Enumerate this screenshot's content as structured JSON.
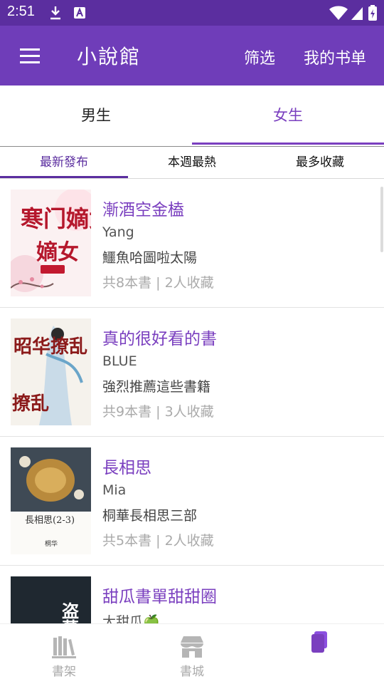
{
  "status_bar": {
    "time": "2:51"
  },
  "app_bar": {
    "title": "小說館",
    "filter_label": "筛选",
    "my_booklist_label": "我的书单"
  },
  "gender_tabs": [
    {
      "label": "男生",
      "active": false
    },
    {
      "label": "女生",
      "active": true
    }
  ],
  "sort_tabs": [
    {
      "label": "最新發布",
      "active": true
    },
    {
      "label": "本週最熱",
      "active": false
    },
    {
      "label": "最多收藏",
      "active": false
    }
  ],
  "booklists": [
    {
      "title": "漸酒空金榼",
      "author": "Yang",
      "description": "鱷魚哈圖啦太陽",
      "stats": "共8本書 | 2人收藏",
      "cover_text": "寒门嫡女"
    },
    {
      "title": "真的很好看的書",
      "author": "BLUE",
      "description": "強烈推薦這些書籍",
      "stats": "共9本書 | 3人收藏",
      "cover_text": "昭华撩乱"
    },
    {
      "title": "長相思",
      "author": "Mia",
      "description": "桐華長相思三部",
      "stats": "共5本書 | 2人收藏",
      "cover_text": "長相思(2-3)",
      "cover_author": "桐华"
    },
    {
      "title": "甜瓜書單甜甜圈",
      "author": "大甜瓜🍏",
      "description": "",
      "stats": "",
      "cover_text": "盗墓笔"
    }
  ],
  "bottom_nav": [
    {
      "label": "書架",
      "icon": "bookshelf-icon"
    },
    {
      "label": "書城",
      "icon": "store-icon"
    },
    {
      "label": "",
      "icon": "booklist-icon",
      "active": true
    }
  ],
  "colors": {
    "primary": "#6f3db9",
    "status_bar": "#5b2e9f",
    "accent": "#7a3fbf",
    "muted": "#aaaaaa"
  }
}
